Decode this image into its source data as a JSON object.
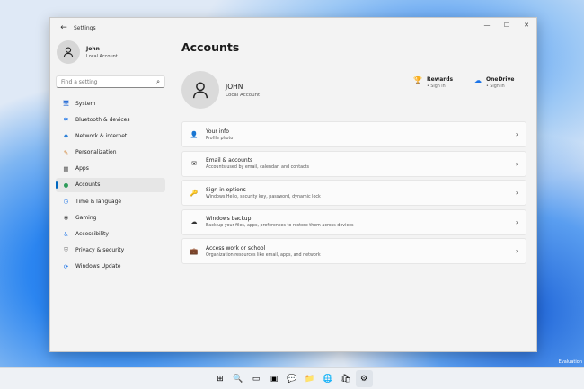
{
  "window": {
    "title": "Settings",
    "controls": [
      "—",
      "☐",
      "✕"
    ]
  },
  "sidebar": {
    "user": {
      "name": "John",
      "type": "Local Account"
    },
    "search_placeholder": "Find a setting",
    "items": [
      {
        "label": "System",
        "icon": "🖥",
        "color": "#2b6fd6"
      },
      {
        "label": "Bluetooth & devices",
        "icon": "✱",
        "color": "#1a73e8"
      },
      {
        "label": "Network & internet",
        "icon": "◆",
        "color": "#2b7fd6"
      },
      {
        "label": "Personalization",
        "icon": "✎",
        "color": "#d08030"
      },
      {
        "label": "Apps",
        "icon": "▦",
        "color": "#555"
      },
      {
        "label": "Accounts",
        "icon": "●",
        "color": "#2e9b5a"
      },
      {
        "label": "Time & language",
        "icon": "◷",
        "color": "#1a73e8"
      },
      {
        "label": "Gaming",
        "icon": "◉",
        "color": "#555"
      },
      {
        "label": "Accessibility",
        "icon": "♿",
        "color": "#1a73e8"
      },
      {
        "label": "Privacy & security",
        "icon": "⛨",
        "color": "#666"
      },
      {
        "label": "Windows Update",
        "icon": "⟳",
        "color": "#1a73e8"
      }
    ],
    "selected": "Accounts"
  },
  "main": {
    "title": "Accounts",
    "user": {
      "name": "JOHN",
      "type": "Local Account"
    },
    "services": [
      {
        "name": "Rewards",
        "status": "• Sign in",
        "icon": "🏆"
      },
      {
        "name": "OneDrive",
        "status": "• Sign in",
        "icon": "☁"
      }
    ],
    "cards": [
      {
        "title": "Your info",
        "subtitle": "Profile photo",
        "icon": "👤"
      },
      {
        "title": "Email & accounts",
        "subtitle": "Accounts used by email, calendar, and contacts",
        "icon": "✉"
      },
      {
        "title": "Sign-in options",
        "subtitle": "Windows Hello, security key, password, dynamic lock",
        "icon": "🔑"
      },
      {
        "title": "Windows backup",
        "subtitle": "Back up your files, apps, preferences to restore them across devices",
        "icon": "☁"
      },
      {
        "title": "Access work or school",
        "subtitle": "Organization resources like email, apps, and network",
        "icon": "💼"
      }
    ]
  },
  "desktop": {
    "watermark": "Evaluation"
  },
  "taskbar": [
    "⊞",
    "🔍",
    "▭",
    "▣",
    "💬",
    "📁",
    "🌐",
    "🛍",
    "⚙"
  ]
}
